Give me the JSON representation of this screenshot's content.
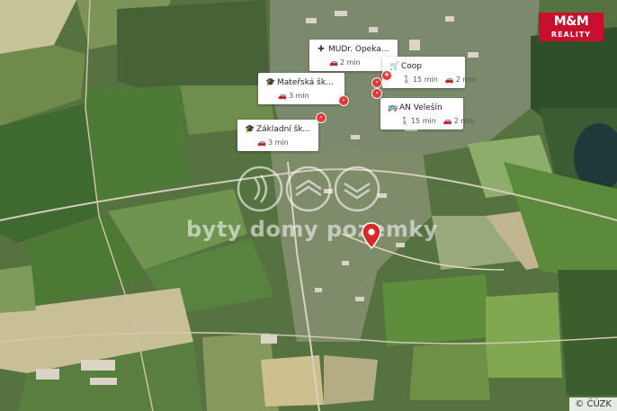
{
  "map": {
    "attribution": "© ČÚZK",
    "watermark_text": "byty domy pozemky",
    "logo": {
      "top": "M&M",
      "bottom": "REALITY"
    }
  },
  "pois": [
    {
      "name": "MUDr. Opekar Ivo",
      "icon": "medical-icon",
      "walk": "",
      "drive": "2 min"
    },
    {
      "name": "Mateřská škola v...",
      "icon": "school-icon",
      "walk": "",
      "drive": "3 min"
    },
    {
      "name": "Coop",
      "icon": "cart-icon",
      "walk": "15 min",
      "drive": "2 min"
    },
    {
      "name": "AN Velešín",
      "icon": "bus-icon",
      "walk": "15 min",
      "drive": "2 min"
    },
    {
      "name": "Základní škola Ve...",
      "icon": "school-icon",
      "walk": "",
      "drive": "3 min"
    }
  ],
  "colors": {
    "pin": "#d62b2b",
    "brand": "#c8102e"
  }
}
